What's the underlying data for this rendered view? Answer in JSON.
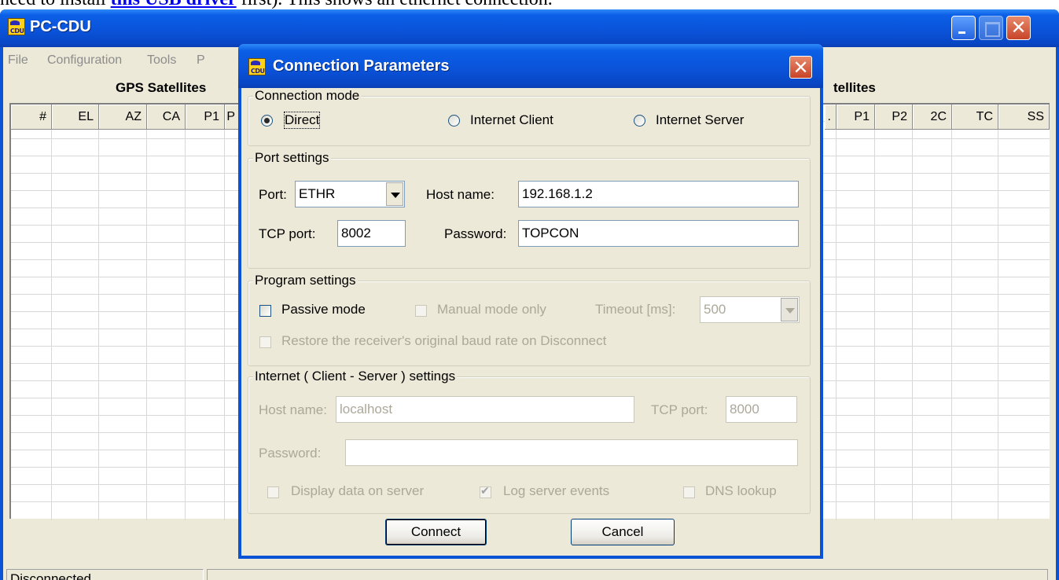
{
  "doc_top": {
    "prefix": "need to install ",
    "link": "this USB driver",
    "suffix": " first). This shows an ethernet connection."
  },
  "app": {
    "title": "PC-CDU",
    "icon_text": "CDU",
    "menu": [
      "File",
      "Configuration",
      "Tools",
      "P"
    ],
    "gps_header": "GPS Satellites",
    "right_header": "tellites",
    "left_columns": [
      "#",
      "EL",
      "AZ",
      "CA",
      "P1",
      "P"
    ],
    "right_columns": [
      ".",
      "P1",
      "P2",
      "2C",
      "TC",
      "SS"
    ],
    "status": "Disconnected"
  },
  "dialog": {
    "title": "Connection Parameters",
    "connection_mode": {
      "label": "Connection mode",
      "options": [
        "Direct",
        "Internet Client",
        "Internet Server"
      ],
      "selected": "Direct"
    },
    "port_settings": {
      "label": "Port settings",
      "port_label": "Port:",
      "port_value": "ETHR",
      "host_label": "Host name:",
      "host_value": "192.168.1.2",
      "tcp_label": "TCP port:",
      "tcp_value": "8002",
      "password_label": "Password:",
      "password_value": "TOPCON"
    },
    "program_settings": {
      "label": "Program settings",
      "passive": "Passive mode",
      "manual": "Manual mode only",
      "timeout_label": "Timeout [ms]:",
      "timeout_value": "500",
      "restore": "Restore the receiver's original baud rate on Disconnect"
    },
    "internet_settings": {
      "label": "Internet ( Client - Server ) settings",
      "host_label": "Host name:",
      "host_value": "localhost",
      "tcp_label": "TCP port:",
      "tcp_value": "8000",
      "password_label": "Password:",
      "password_value": "",
      "display_data": "Display data on server",
      "log_events": "Log server events",
      "dns": "DNS lookup"
    },
    "buttons": {
      "connect": "Connect",
      "cancel": "Cancel"
    }
  }
}
